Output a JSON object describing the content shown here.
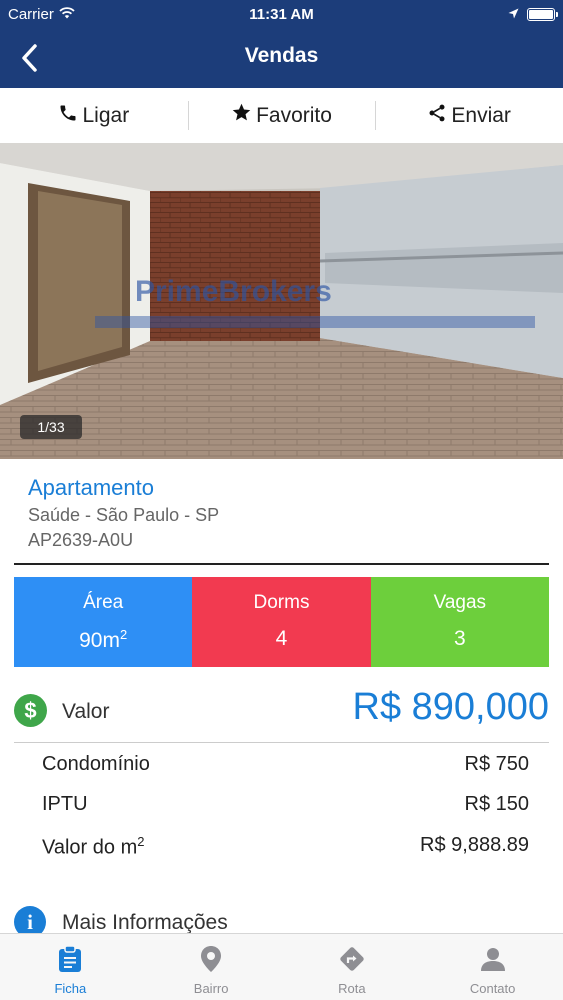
{
  "status_bar": {
    "carrier": "Carrier",
    "time": "11:31 AM"
  },
  "nav": {
    "title": "Vendas"
  },
  "actions": [
    {
      "label": "Ligar",
      "icon": "phone-icon"
    },
    {
      "label": "Favorito",
      "icon": "star-icon"
    },
    {
      "label": "Enviar",
      "icon": "share-icon"
    }
  ],
  "photo": {
    "counter": "1/33",
    "watermark": "PrimeBrokers"
  },
  "property": {
    "type": "Apartamento",
    "location": "Saúde - São Paulo - SP",
    "code": "AP2639-A0U"
  },
  "stats": [
    {
      "label": "Área",
      "value": "90m",
      "sup": "2",
      "color": "#2e8ff5"
    },
    {
      "label": "Dorms",
      "value": "4",
      "sup": "",
      "color": "#f23a50"
    },
    {
      "label": "Vagas",
      "value": "3",
      "sup": "",
      "color": "#6dcf3c"
    }
  ],
  "valor": {
    "label": "Valor",
    "price": "R$ 890,000"
  },
  "details": [
    {
      "label": "Condomínio",
      "sup": "",
      "value": "R$ 750"
    },
    {
      "label": "IPTU",
      "sup": "",
      "value": "R$ 150"
    },
    {
      "label": "Valor do m",
      "sup": "2",
      "value": "R$ 9,888.89"
    }
  ],
  "more_info": {
    "label": "Mais Informações"
  },
  "tabs": [
    {
      "label": "Ficha",
      "icon": "clipboard-icon",
      "active": true
    },
    {
      "label": "Bairro",
      "icon": "map-pin-icon",
      "active": false
    },
    {
      "label": "Rota",
      "icon": "directions-icon",
      "active": false
    },
    {
      "label": "Contato",
      "icon": "person-icon",
      "active": false
    }
  ],
  "colors": {
    "nav_bg": "#1c3d7a",
    "accent": "#1a7ed6",
    "valor_icon": "#3fa64a"
  }
}
